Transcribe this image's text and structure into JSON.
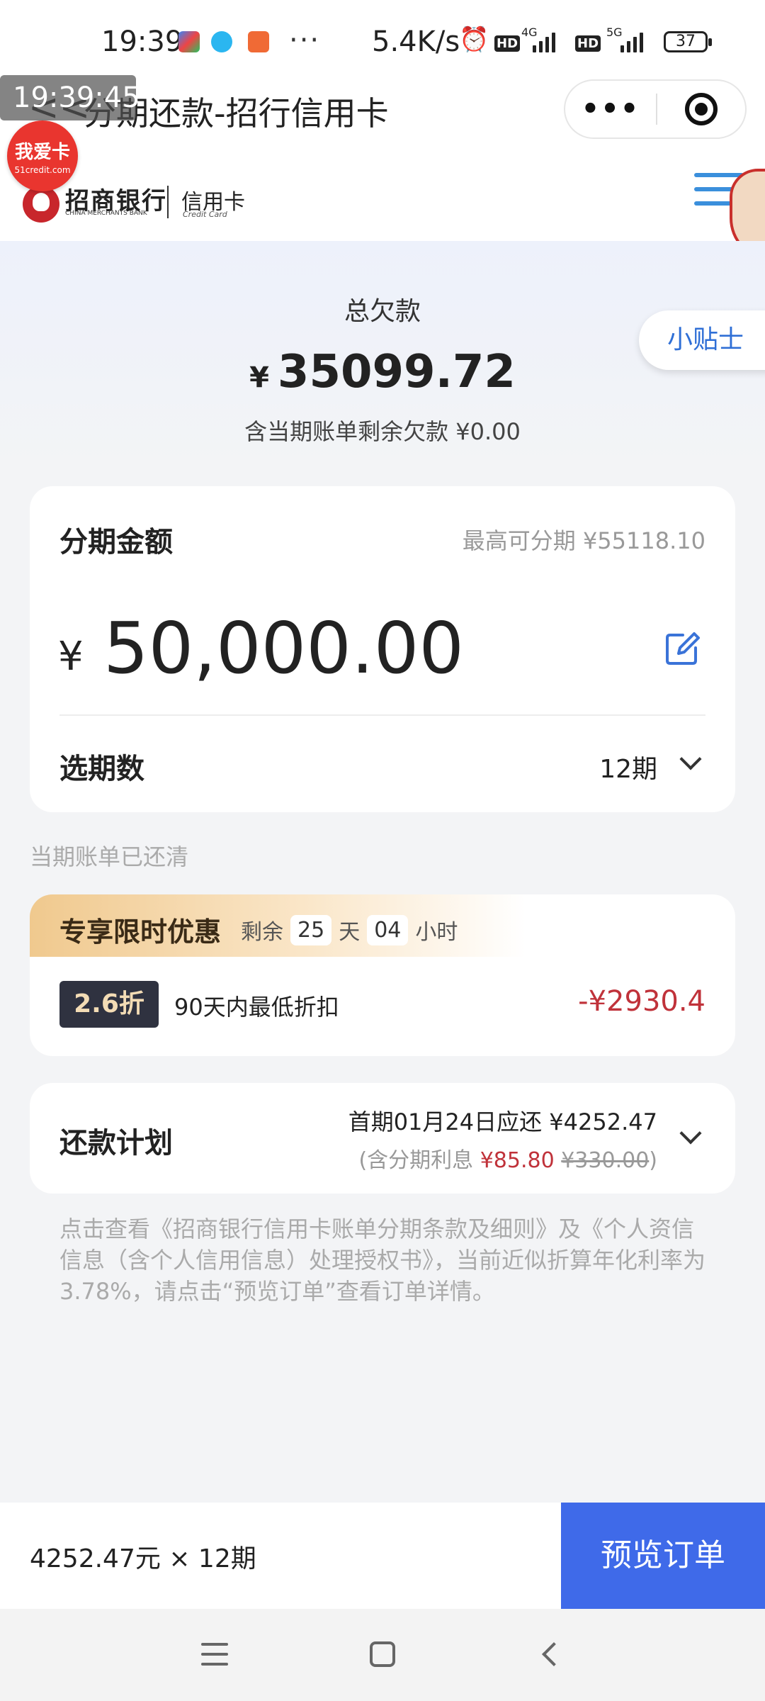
{
  "status_bar": {
    "time": "19:39",
    "more": "···",
    "net_speed": "5.4K/s",
    "hd1": "HD",
    "net1": "4G",
    "hd2": "HD",
    "net2": "5G",
    "battery": "37"
  },
  "overlay_time": "19:39:45",
  "header": {
    "back": "<<",
    "title": "分期还款-招行信用卡",
    "more": "•••"
  },
  "badge": {
    "line1": "我爱卡",
    "line2": "51credit.com"
  },
  "bank": {
    "name_cn": "招商银行",
    "name_en": "CHINA MERCHANTS BANK",
    "card_cn": "信用卡",
    "card_en": "Credit Card"
  },
  "summary": {
    "total_label": "总欠款",
    "currency": "¥",
    "total_amount": "35099.72",
    "sub_text": "含当期账单剩余欠款 ¥0.00",
    "tips": "小贴士"
  },
  "amount_card": {
    "label": "分期金额",
    "max_text": "最高可分期 ¥55118.10",
    "currency": "¥",
    "amount": "50,000.00",
    "period_label": "选期数",
    "period_value": "12期"
  },
  "cleared_note": "当期账单已还清",
  "promo": {
    "title": "专享限时优惠",
    "remain_prefix": "剩余",
    "days": "25",
    "day_unit": "天",
    "hours": "04",
    "hour_unit": "小时",
    "discount": "2.6折",
    "discount_text": "90天内最低折扣",
    "discount_amount": "-¥2930.4"
  },
  "plan": {
    "label": "还款计划",
    "first_payment": "首期01月24日应还 ¥4252.47",
    "interest_prefix": "(含分期利息 ",
    "interest_new": "¥85.80",
    "interest_old": "¥330.00",
    "interest_suffix": ")"
  },
  "terms": "点击查看《招商银行信用卡账单分期条款及细则》及《个人资信信息（含个人信用信息）处理授权书》，当前近似折算年化利率为3.78%，请点击“预览订单”查看订单详情。",
  "bottom": {
    "summary": "4252.47元 × 12期",
    "button": "预览订单"
  },
  "colors": {
    "primary_button": "#3f6ae9",
    "discount_red": "#c0323a",
    "tips_blue": "#2f6fd6"
  }
}
